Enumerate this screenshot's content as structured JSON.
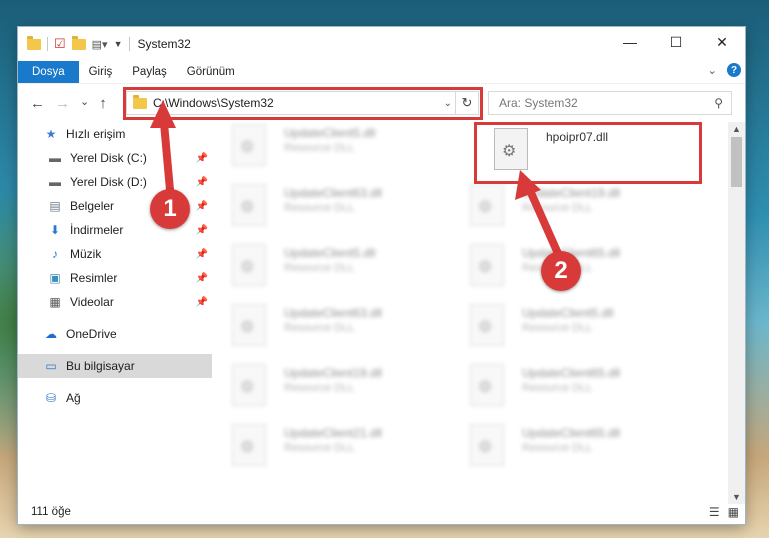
{
  "window": {
    "title": "System32",
    "controls": {
      "minimize": "—",
      "maximize": "☐",
      "close": "✕"
    }
  },
  "ribbon": {
    "tabs": [
      "Dosya",
      "Giriş",
      "Paylaş",
      "Görünüm"
    ],
    "help": "?",
    "expand": "⌄"
  },
  "address": {
    "path": "C:\\Windows\\System32",
    "refresh": "↻",
    "dropdown": "⌄"
  },
  "search": {
    "placeholder": "Ara: System32"
  },
  "nav": {
    "back": "←",
    "forward": "→",
    "recent": "⌄",
    "up": "↑"
  },
  "sidebar": [
    {
      "label": "Hızlı erişim",
      "icon": "★",
      "pinned": false
    },
    {
      "label": "Yerel Disk (C:)",
      "icon": "▬",
      "pinned": true
    },
    {
      "label": "Yerel Disk (D:)",
      "icon": "▬",
      "pinned": true
    },
    {
      "label": "Belgeler",
      "icon": "▤",
      "pinned": true
    },
    {
      "label": "İndirmeler",
      "icon": "⬇",
      "pinned": true
    },
    {
      "label": "Müzik",
      "icon": "♪",
      "pinned": true
    },
    {
      "label": "Resimler",
      "icon": "▣",
      "pinned": true
    },
    {
      "label": "Videolar",
      "icon": "▦",
      "pinned": true
    },
    {
      "label": "OneDrive",
      "icon": "☁",
      "pinned": false
    },
    {
      "label": "Bu bilgisayar",
      "icon": "▭",
      "pinned": false
    },
    {
      "label": "Ağ",
      "icon": "⛁",
      "pinned": false
    }
  ],
  "files": {
    "left_column": [
      {
        "name": "UpdateClient5.dll",
        "type": "Resource DLL"
      },
      {
        "name": "UpdateClient63.dll",
        "type": "Resource DLL"
      },
      {
        "name": "UpdateClient5.dll",
        "type": "Resource DLL"
      },
      {
        "name": "UpdateClient63.dll",
        "type": "Resource DLL"
      },
      {
        "name": "UpdateClient19.dll",
        "type": "Resource DLL"
      },
      {
        "name": "UpdateClient21.dll",
        "type": "Resource DLL"
      }
    ],
    "right_column": [
      {
        "name": "hpoipr07.dll",
        "type": ""
      },
      {
        "name": "UpdateClient19.dll",
        "type": "Resource DLL"
      },
      {
        "name": "UpdateClient65.dll",
        "type": "Resource DLL"
      },
      {
        "name": "UpdateClient5.dll",
        "type": "Resource DLL"
      },
      {
        "name": "UpdateClient65.dll",
        "type": "Resource DLL"
      },
      {
        "name": "UpdateClient65.dll",
        "type": "Resource DLL"
      }
    ]
  },
  "status": {
    "count": "111 öğe"
  },
  "annotations": {
    "badge1": "1",
    "badge2": "2",
    "color": "#d83a3a"
  }
}
